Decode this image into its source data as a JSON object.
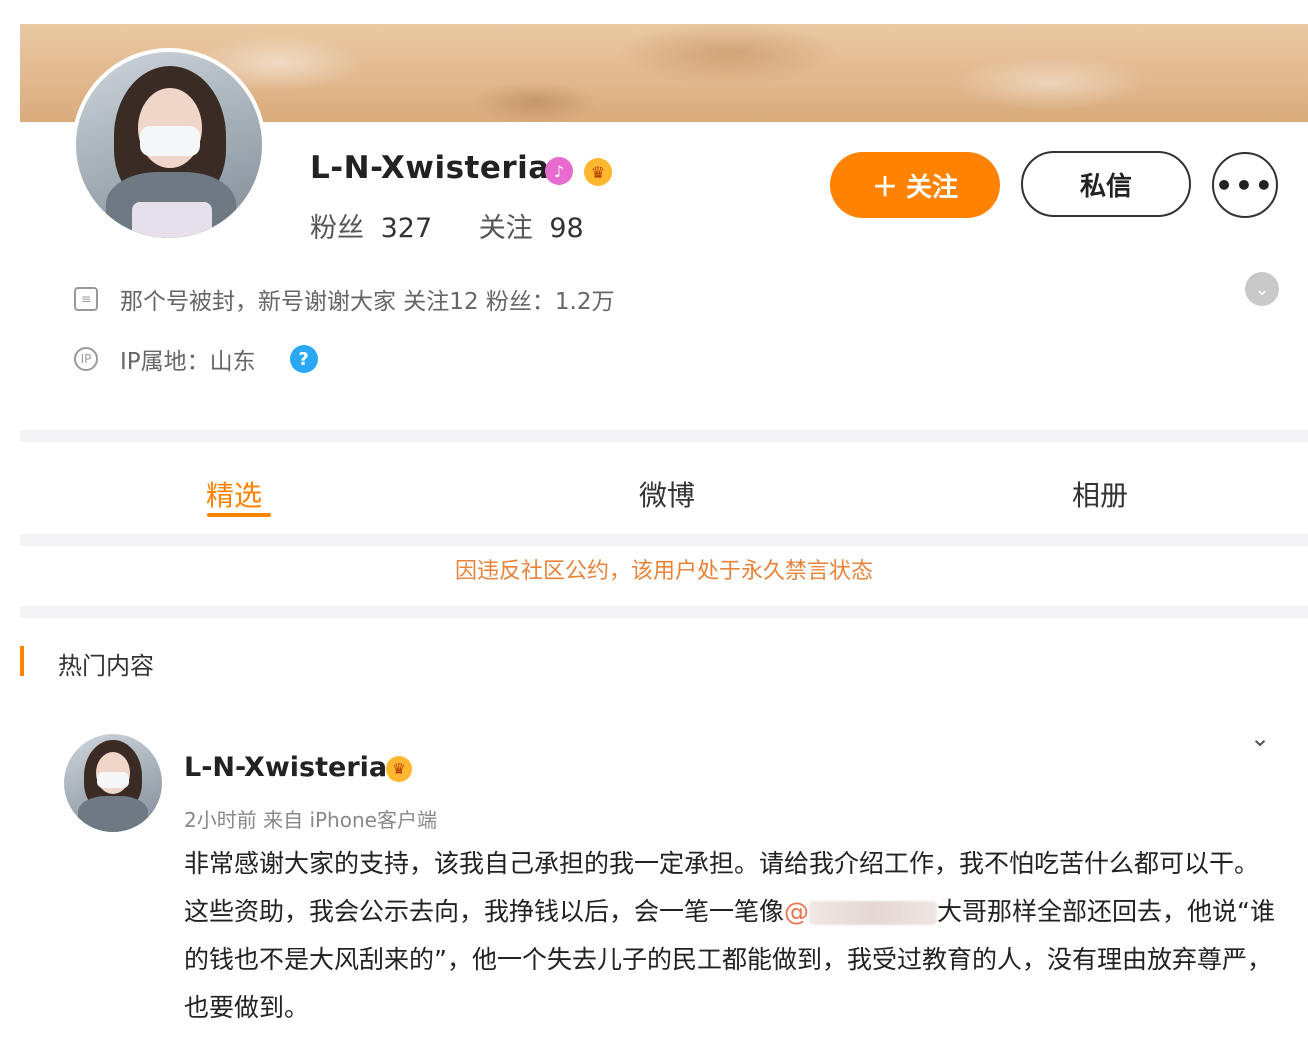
{
  "profile": {
    "username": "L-N-Xwisteria",
    "fans_label": "粉丝",
    "fans_count": "327",
    "following_label": "关注",
    "following_count": "98",
    "bio": "那个号被封，新号谢谢大家 关注12 粉丝：1.2万",
    "ip_location": "IP属地：山东",
    "help_icon": "?"
  },
  "actions": {
    "follow_label": "关注",
    "message_label": "私信",
    "more_label": "•••"
  },
  "tabs": [
    {
      "label": "精选"
    },
    {
      "label": "微博"
    },
    {
      "label": "相册"
    }
  ],
  "notice": "因违反社区公约，该用户处于永久禁言状态",
  "section_title": "热门内容",
  "post": {
    "author": "L-N-Xwisteria",
    "meta": "2小时前  来自 iPhone客户端",
    "text_part1": "非常感谢大家的支持，该我自己承担的我一定承担。请给我介绍工作，我不怕吃苦什么都可以干。 这些资助，我会公示去向，我挣钱以后，会一笔一笔像",
    "mention_symbol": "@",
    "text_part2": "大哥那样全部还回去，他说“谁的钱也不是大风刮来的”，他一个失去儿子的民工都能做到，我受过教育的人，没有理由放弃尊严，也要做到。"
  },
  "colors": {
    "accent": "#ff8200",
    "notice": "#e8833a",
    "help": "#2aa8f5",
    "vip": "#ffb72f"
  }
}
